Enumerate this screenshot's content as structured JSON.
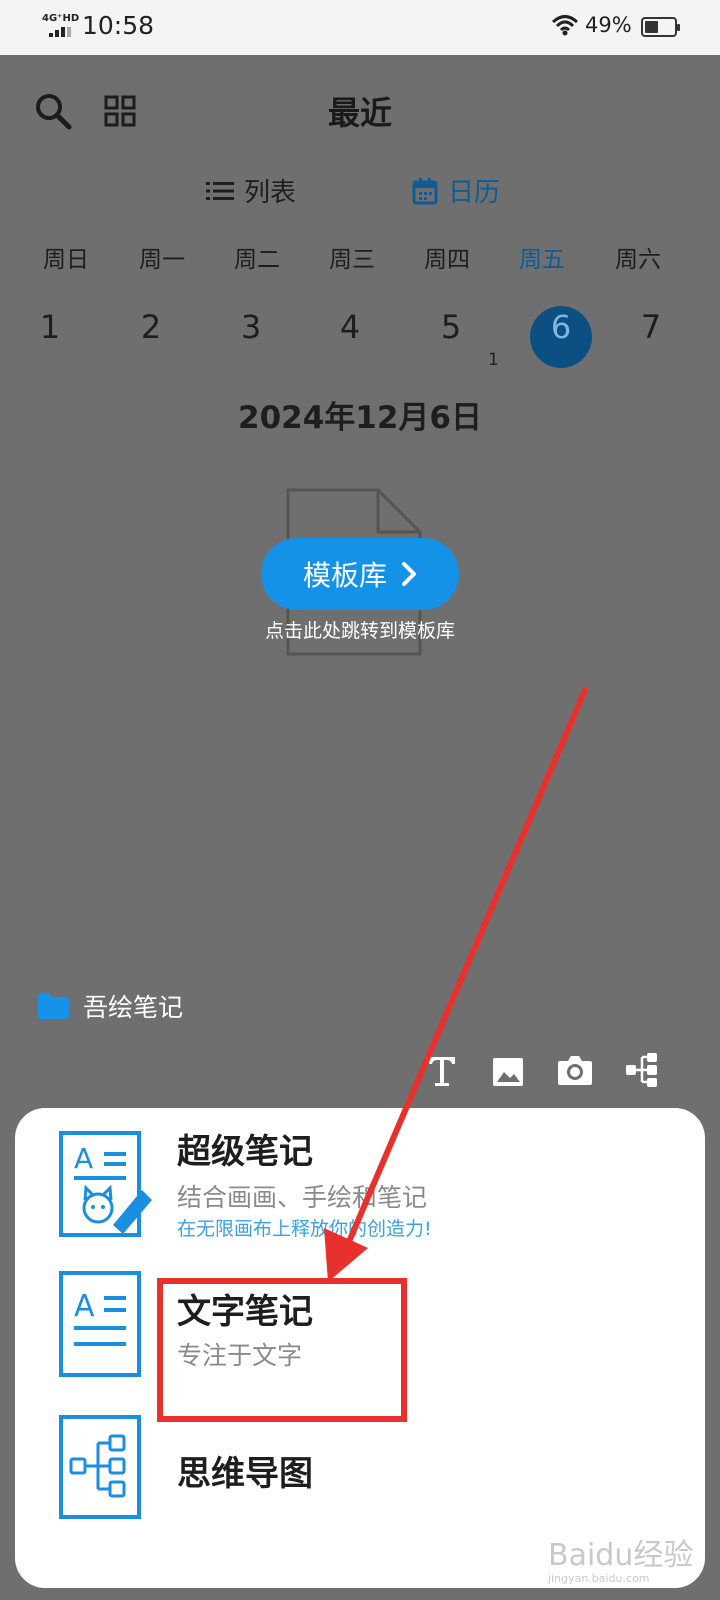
{
  "status_bar": {
    "network": "4G⁺HD",
    "time": "10:58",
    "battery_percent": "49%",
    "battery_level": 0.49
  },
  "header": {
    "title": "最近",
    "search_icon": "search-icon",
    "grid_icon": "grid-icon"
  },
  "view_tabs": {
    "list_label": "列表",
    "calendar_label": "日历",
    "active": "calendar"
  },
  "calendar": {
    "weekdays": [
      "周日",
      "周一",
      "周二",
      "周三",
      "周四",
      "周五",
      "周六"
    ],
    "days": [
      "1",
      "2",
      "3",
      "4",
      "5",
      "6",
      "7"
    ],
    "today_index": 5,
    "day5_count": "1",
    "selected_date": "2024年12月6日"
  },
  "empty_state": {
    "template_button": "模板库",
    "hint": "点击此处跳转到模板库"
  },
  "folder": {
    "name": "吾绘笔记"
  },
  "tools": [
    "text-icon",
    "image-icon",
    "camera-icon",
    "mindmap-icon"
  ],
  "new_note_sheet": {
    "super_note": {
      "title": "超级笔记",
      "subtitle": "结合画画、手绘和笔记",
      "tagline": "在无限画布上释放你的创造力!"
    },
    "text_note": {
      "title": "文字笔记",
      "subtitle": "专注于文字"
    },
    "mind_map": {
      "title": "思维导图"
    }
  },
  "watermark": {
    "brand": "Baidu经验",
    "url": "jingyan.baidu.com"
  },
  "colors": {
    "accent": "#1492e8",
    "overlay": "#6f6f6f",
    "annotation": "#e8312d",
    "today": "#0c4f82"
  }
}
